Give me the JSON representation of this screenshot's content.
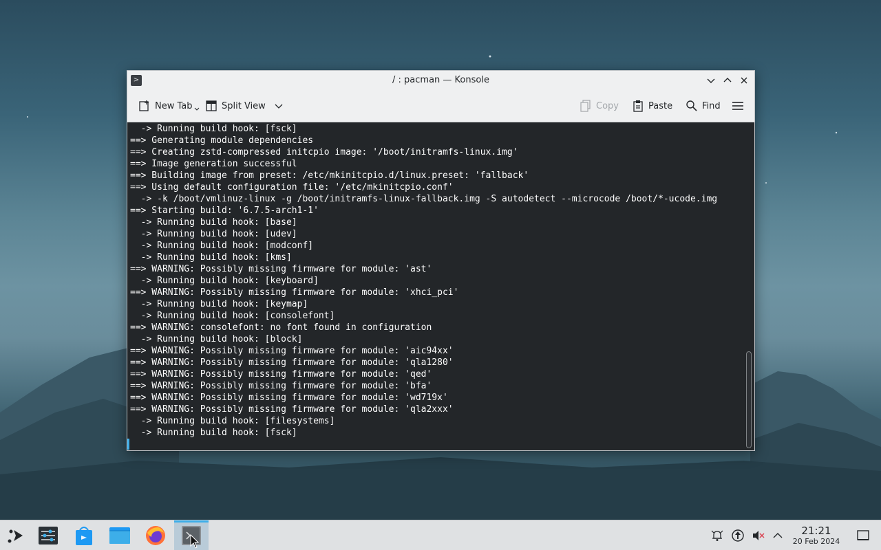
{
  "window": {
    "title": "/ : pacman — Konsole"
  },
  "toolbar": {
    "new_tab": "New Tab",
    "split_view": "Split View",
    "copy": "Copy",
    "paste": "Paste",
    "find": "Find"
  },
  "terminal": {
    "lines": [
      "  -> Running build hook: [fsck]",
      "==> Generating module dependencies",
      "==> Creating zstd-compressed initcpio image: '/boot/initramfs-linux.img'",
      "==> Image generation successful",
      "==> Building image from preset: /etc/mkinitcpio.d/linux.preset: 'fallback'",
      "==> Using default configuration file: '/etc/mkinitcpio.conf'",
      "  -> -k /boot/vmlinuz-linux -g /boot/initramfs-linux-fallback.img -S autodetect --microcode /boot/*-ucode.img",
      "==> Starting build: '6.7.5-arch1-1'",
      "  -> Running build hook: [base]",
      "  -> Running build hook: [udev]",
      "  -> Running build hook: [modconf]",
      "  -> Running build hook: [kms]",
      "==> WARNING: Possibly missing firmware for module: 'ast'",
      "  -> Running build hook: [keyboard]",
      "==> WARNING: Possibly missing firmware for module: 'xhci_pci'",
      "  -> Running build hook: [keymap]",
      "  -> Running build hook: [consolefont]",
      "==> WARNING: consolefont: no font found in configuration",
      "  -> Running build hook: [block]",
      "==> WARNING: Possibly missing firmware for module: 'aic94xx'",
      "==> WARNING: Possibly missing firmware for module: 'qla1280'",
      "==> WARNING: Possibly missing firmware for module: 'qed'",
      "==> WARNING: Possibly missing firmware for module: 'bfa'",
      "==> WARNING: Possibly missing firmware for module: 'wd719x'",
      "==> WARNING: Possibly missing firmware for module: 'qla2xxx'",
      "  -> Running build hook: [filesystems]",
      "  -> Running build hook: [fsck]"
    ]
  },
  "taskbar": {
    "apps": [
      "application-launcher-icon",
      "system-settings-icon",
      "discover-icon",
      "dolphin-icon",
      "firefox-icon",
      "konsole-icon"
    ],
    "active_app": "konsole"
  },
  "tray": {
    "icons": [
      "notifications-icon",
      "network-icon",
      "volume-muted-icon",
      "tray-expand-icon"
    ]
  },
  "clock": {
    "time": "21:21",
    "date": "20 Feb 2024"
  },
  "colors": {
    "accent": "#3daee9",
    "terminal_bg": "#232629",
    "terminal_fg": "#fcfcfc"
  }
}
